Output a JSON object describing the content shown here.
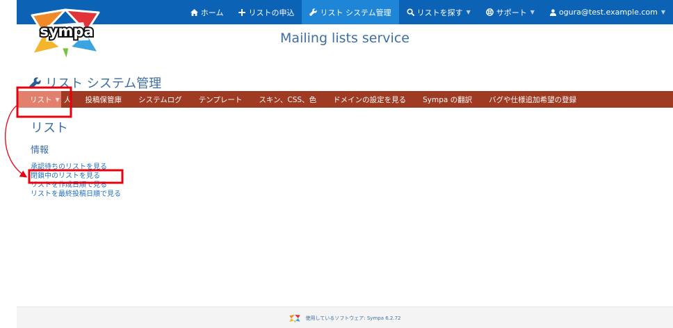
{
  "topnav": {
    "home": "ホーム",
    "request": "リストの申込",
    "admin": "リスト システム管理",
    "search": "リストを探す",
    "support": "サポート",
    "user": "ogura@test.example.com"
  },
  "logo": {
    "text": "sympa"
  },
  "header": {
    "service_title": "Mailing lists service",
    "admin_title": "リスト システム管理"
  },
  "admin_menu": {
    "items": [
      "リスト",
      "人",
      "投稿保管庫",
      "システムログ",
      "テンプレート",
      "スキン、CSS、色",
      "ドメインの設定を見る",
      "Sympa の翻訳",
      "バグや仕様追加希望の登録"
    ]
  },
  "content": {
    "heading": "リスト",
    "subheading": "情報",
    "links": [
      "承認待ちのリストを見る",
      "閉鎖中のリストを見る",
      "リストを作成日順で見る",
      "リストを最終投稿日順で見る"
    ]
  },
  "footer": {
    "text": "使用しているソフトウェア: Sympa 6.2.72"
  },
  "colors": {
    "topbar": "#0c62b4",
    "topbar_active": "#1f85d6",
    "menubar": "#9f3a23",
    "menu_active": "#e2806d",
    "title": "#3d6ea6",
    "link": "#1f6fbf",
    "highlight": "#e8000e"
  }
}
